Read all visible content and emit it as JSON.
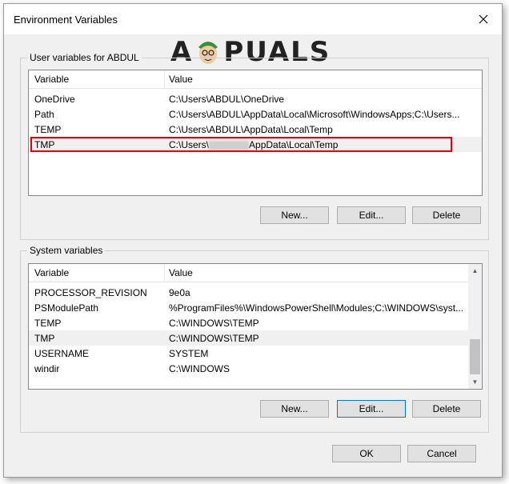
{
  "window": {
    "title": "Environment Variables"
  },
  "watermark": {
    "letter_a": "A",
    "rest": "PUALS"
  },
  "user_vars": {
    "group_label": "User variables for ABDUL",
    "col_variable": "Variable",
    "col_value": "Value",
    "rows": [
      {
        "name": "OneDrive",
        "value": "C:\\Users\\ABDUL\\OneDrive"
      },
      {
        "name": "Path",
        "value": "C:\\Users\\ABDUL\\AppData\\Local\\Microsoft\\WindowsApps;C:\\Users..."
      },
      {
        "name": "TEMP",
        "value": "C:\\Users\\ABDUL\\AppData\\Local\\Temp"
      },
      {
        "name": "TMP",
        "value_prefix": "C:\\Users\\",
        "value_suffix": "AppData\\Local\\Temp"
      }
    ],
    "buttons": {
      "new": "New...",
      "edit": "Edit...",
      "delete": "Delete"
    }
  },
  "system_vars": {
    "group_label": "System variables",
    "col_variable": "Variable",
    "col_value": "Value",
    "rows": [
      {
        "name": "PROCESSOR_REVISION",
        "value": "9e0a"
      },
      {
        "name": "PSModulePath",
        "value": "%ProgramFiles%\\WindowsPowerShell\\Modules;C:\\WINDOWS\\syst..."
      },
      {
        "name": "TEMP",
        "value": "C:\\WINDOWS\\TEMP"
      },
      {
        "name": "TMP",
        "value": "C:\\WINDOWS\\TEMP"
      },
      {
        "name": "USERNAME",
        "value": "SYSTEM"
      },
      {
        "name": "windir",
        "value": "C:\\WINDOWS"
      }
    ],
    "buttons": {
      "new": "New...",
      "edit": "Edit...",
      "delete": "Delete"
    }
  },
  "footer": {
    "ok": "OK",
    "cancel": "Cancel"
  },
  "colors": {
    "highlight_border": "#e00000",
    "focus_border": "#0078d7"
  }
}
